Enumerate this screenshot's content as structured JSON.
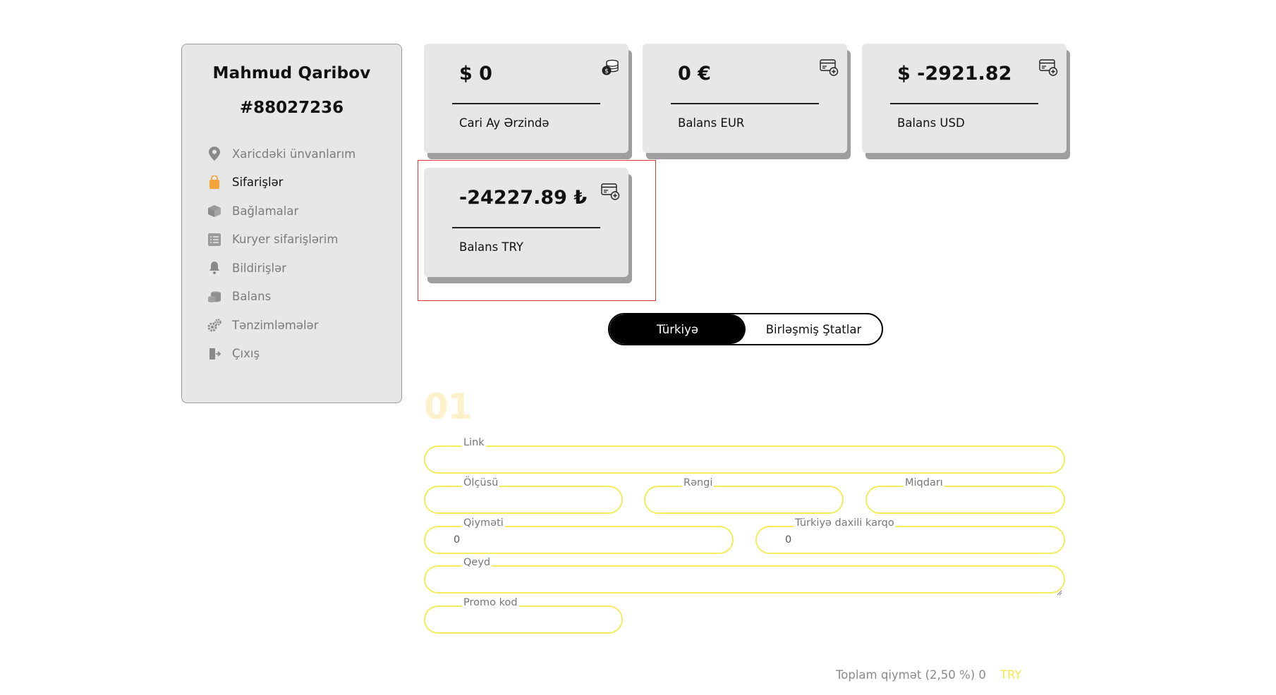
{
  "profile": {
    "name": "Mahmud Qaribov",
    "id": "#88027236"
  },
  "menu": [
    {
      "label": "Xaricdəki ünvanlarım",
      "icon": "location-pin-icon",
      "active": false
    },
    {
      "label": "Sifarişlər",
      "icon": "shopping-bag-icon",
      "active": true
    },
    {
      "label": "Bağlamalar",
      "icon": "package-icon",
      "active": false
    },
    {
      "label": "Kuryer sifarişlərim",
      "icon": "checklist-icon",
      "active": false
    },
    {
      "label": "Bildirişlər",
      "icon": "bell-icon",
      "active": false
    },
    {
      "label": "Balans",
      "icon": "coins-icon",
      "active": false
    },
    {
      "label": "Tənzimləmələr",
      "icon": "gears-icon",
      "active": false
    },
    {
      "label": "Çıxış",
      "icon": "logout-icon",
      "active": false
    }
  ],
  "cards": [
    {
      "value": "$ 0",
      "label": "Cari Ay Ərzində",
      "icon": "coins-stack-icon"
    },
    {
      "value": "0 €",
      "label": "Balans EUR",
      "icon": "add-card-icon"
    },
    {
      "value": "$ -2921.82",
      "label": "Balans USD",
      "icon": "add-card-icon"
    },
    {
      "value": "-24227.89 ₺",
      "label": "Balans TRY",
      "icon": "add-card-icon"
    }
  ],
  "toggle": {
    "options": [
      "Türkiyə",
      "Birləşmiş Ştatlar"
    ],
    "selected": "Türkiyə"
  },
  "form": {
    "step": "01",
    "link": {
      "label": "Link",
      "value": ""
    },
    "size": {
      "label": "Ölçüsü",
      "value": ""
    },
    "color": {
      "label": "Rəngi",
      "value": ""
    },
    "quantity": {
      "label": "Miqdarı",
      "value": ""
    },
    "price": {
      "label": "Qiyməti",
      "value": "0"
    },
    "domestic_cargo": {
      "label": "Türkiyə daxili karqo",
      "value": "0"
    },
    "note": {
      "label": "Qeyd",
      "value": ""
    },
    "promo": {
      "label": "Promo kod",
      "value": ""
    }
  },
  "total": {
    "text": "Toplam qiymət  (2,50  %) 0",
    "currency": "TRY"
  },
  "colors": {
    "accent_yellow": "#f5ec5a",
    "highlight_red": "#e23030",
    "active_icon_orange": "#f4a53a"
  }
}
